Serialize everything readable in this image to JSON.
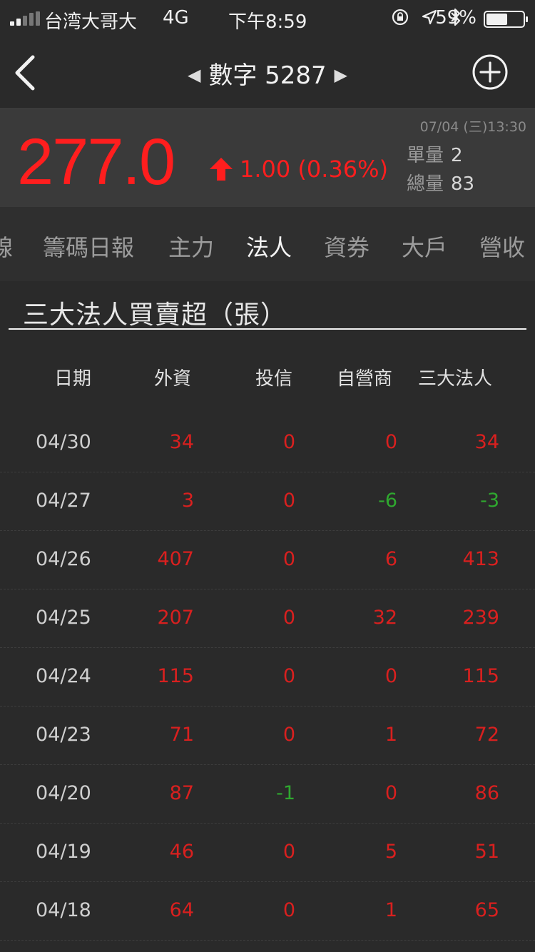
{
  "status_bar": {
    "carrier": "台湾大哥大",
    "network": "4G",
    "time": "下午8:59",
    "battery": "59%",
    "battery_level": 0.59,
    "icons": [
      "orientation-lock-icon",
      "location-icon",
      "bluetooth-icon"
    ]
  },
  "nav": {
    "prev_arrow": "◀",
    "title": "數字 5287",
    "next_arrow": "▶"
  },
  "quote": {
    "price": "277.0",
    "change": "1.00 (0.36%)",
    "datetime": "07/04 (三)13:30",
    "unit_volume_label": "單量",
    "unit_volume": "2",
    "total_volume_label": "總量",
    "total_volume": "83",
    "up_color": "#ff1e1e"
  },
  "tabs": [
    {
      "label": "線"
    },
    {
      "label": "籌碼日報"
    },
    {
      "label": "主力"
    },
    {
      "label": "法人"
    },
    {
      "label": "資券"
    },
    {
      "label": "大戶"
    },
    {
      "label": "營收"
    }
  ],
  "active_tab": "法人",
  "section": {
    "title": "三大法人買賣超（張）",
    "columns": [
      "日期",
      "外資",
      "投信",
      "自營商",
      "三大法人"
    ],
    "rows": [
      {
        "date": "04/30",
        "foreign": "34",
        "trust": "0",
        "dealer": "0",
        "total": "34"
      },
      {
        "date": "04/27",
        "foreign": "3",
        "trust": "0",
        "dealer": "-6",
        "total": "-3"
      },
      {
        "date": "04/26",
        "foreign": "407",
        "trust": "0",
        "dealer": "6",
        "total": "413"
      },
      {
        "date": "04/25",
        "foreign": "207",
        "trust": "0",
        "dealer": "32",
        "total": "239"
      },
      {
        "date": "04/24",
        "foreign": "115",
        "trust": "0",
        "dealer": "0",
        "total": "115"
      },
      {
        "date": "04/23",
        "foreign": "71",
        "trust": "0",
        "dealer": "1",
        "total": "72"
      },
      {
        "date": "04/20",
        "foreign": "87",
        "trust": "-1",
        "dealer": "0",
        "total": "86"
      },
      {
        "date": "04/19",
        "foreign": "46",
        "trust": "0",
        "dealer": "5",
        "total": "51"
      },
      {
        "date": "04/18",
        "foreign": "64",
        "trust": "0",
        "dealer": "1",
        "total": "65"
      }
    ]
  },
  "colors": {
    "positive": "#d9201f",
    "negative": "#2fa82f",
    "background": "#2a2a2a"
  }
}
